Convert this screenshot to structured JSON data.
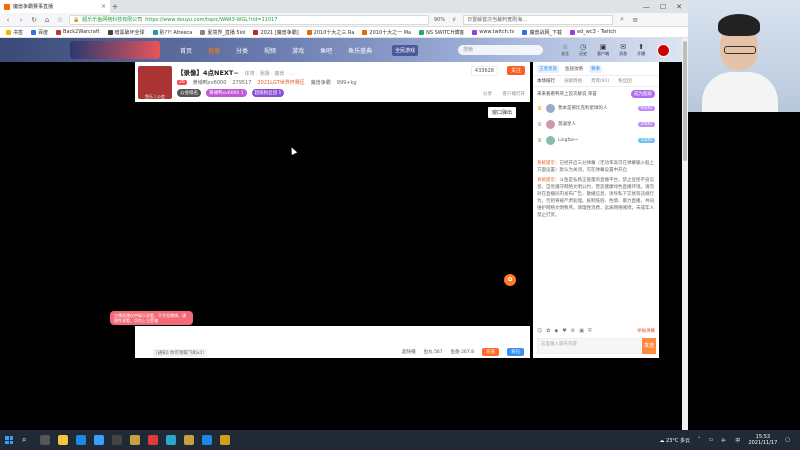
{
  "browser": {
    "tab_title": "魔兽争霸赛事直播",
    "url_prefix": "超乐乐鱼网络科技有限公司",
    "url": "https://www.douyu.com/topic/WAR3-WGL?rid=11017",
    "zoom": "90%",
    "search_text": "日置解首次当裁判宽刚海...",
    "bookmarks": [
      "书签",
      "百度",
      "Back2Warcraft",
      "暗黑破坏全球",
      "别??! Afreeca",
      "夏境界_直播 5iol",
      "2021 [魔兽争霸]",
      "2010十大之三 Ra",
      "2010十大之一 Ma",
      "NS SWITCH博客",
      "www.twitch.tv",
      "魔兽战网_下载",
      "ed_wc3 - Twitch"
    ]
  },
  "site": {
    "nav": [
      "首页",
      "直播",
      "分类",
      "视频",
      "游戏",
      "鱼吧",
      "鱼乐盛典"
    ],
    "active_nav": "直播",
    "promo": "全民游戏",
    "search_placeholder": "搜索",
    "icons": [
      {
        "icon": "☆",
        "label": "关注"
      },
      {
        "icon": "◷",
        "label": "历史"
      },
      {
        "icon": "▣",
        "label": "客户端"
      },
      {
        "icon": "✉",
        "label": "消息"
      },
      {
        "icon": "⬆",
        "label": "开播"
      }
    ]
  },
  "streamer": {
    "title": "【录像】4点NEXT~",
    "subtitle": "体育 · 我播 · 魔兽 · ...",
    "level": "26",
    "name": "黄埔鸭xv6000",
    "fans": "279517",
    "tag": "2021LGT世界杯赛区",
    "hot": "魔兽争霸",
    "weight": "999+kg",
    "avatar_label": "鱼乐 | 公会",
    "pills": [
      "公会排名",
      "黄埔鸭xv6000 1",
      "超级粉丝团 1"
    ],
    "fans_count": "433628",
    "follow_label": "关注",
    "share_label": "分享",
    "client_label": "客户端打开"
  },
  "video": {
    "popout_label": "窗口弹出",
    "toast": "主播直播仅供娱乐观看，不涉及赌博，请理性观看，切勿上当受骗"
  },
  "bottom": {
    "notice": "[通知] 你可领取飞机x1!",
    "buttons": [
      "超快播",
      "鱼丸 567",
      "鱼翅 267.8",
      "充值",
      "背包"
    ]
  },
  "panel": {
    "top": [
      "王者贵族",
      "鱼翅攻略",
      "赛事"
    ],
    "tabs": [
      "本场排行",
      "贡献周榜",
      "贵宾(91)",
      "粉丝团"
    ],
    "announce": "来来看看鸭哥上首次解说 荣誉",
    "announce_btn": "成为超级",
    "ranks": [
      {
        "name": "我本是那比克利星球的人",
        "gold": "9000"
      },
      {
        "name": "莫凝星人",
        "gold": "2000"
      },
      {
        "name": "Lingfan~",
        "gold": "1000"
      }
    ],
    "messages": [
      {
        "tag": "系统提示：",
        "text": "已经开启三分弹幕（无功率高可在弹幕输入框上方面设置）默认为关闭，可在弹幕设置中开启"
      },
      {
        "tag": "系统提示：",
        "text": "斗鱼是弘扬正能量的直播平台，禁止宣扬不良信息，自觉遵守网络文明公约，营造健康绿色直播环境。请勿对在直播间内发布广告、散播信息、诱导私下交易等违规行为，否则将被严肃处理。抵制低俗、色情、暴力直播，共同维护网络文明秩序。请理性消费，远离网络赌博，未成年人禁止打赏。"
      }
    ],
    "report": "举报弹幕",
    "input_placeholder": "这里输入聊天内容",
    "send_label": "发送"
  },
  "taskbar": {
    "weather": "23°C 多云",
    "time": "15:53",
    "date": "2021/11/17"
  },
  "colors": {
    "brand_orange": "#ff5d23",
    "accent_purple": "#b26cf0",
    "blue": "#3c8ef0"
  }
}
